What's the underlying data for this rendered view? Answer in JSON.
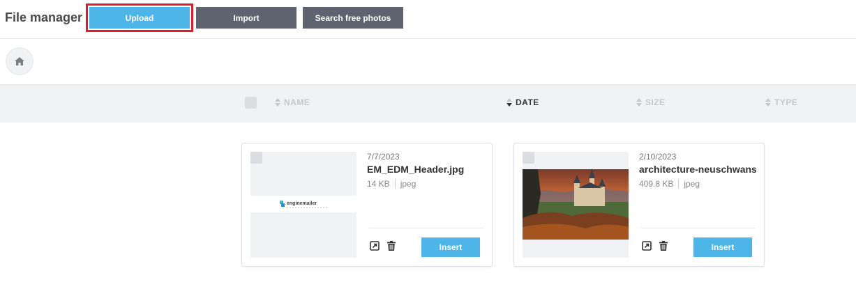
{
  "header": {
    "title": "File manager",
    "upload_label": "Upload",
    "import_label": "Import",
    "search_photos_label": "Search free photos"
  },
  "columns": {
    "name": "NAME",
    "date": "DATE",
    "size": "SIZE",
    "type": "TYPE",
    "active_sort": "date"
  },
  "files": [
    {
      "date": "7/7/2023",
      "name": "EM_EDM_Header.jpg",
      "size": "14 KB",
      "type": "jpeg",
      "insert_label": "Insert",
      "thumb_logo": "enginemailer"
    },
    {
      "date": "2/10/2023",
      "name": "architecture-neuschwanstein",
      "size": "409.8 KB",
      "type": "jpeg",
      "insert_label": "Insert"
    }
  ],
  "colors": {
    "primary": "#4eb5e9",
    "secondary": "#5f6370",
    "highlight": "#d8202a"
  }
}
